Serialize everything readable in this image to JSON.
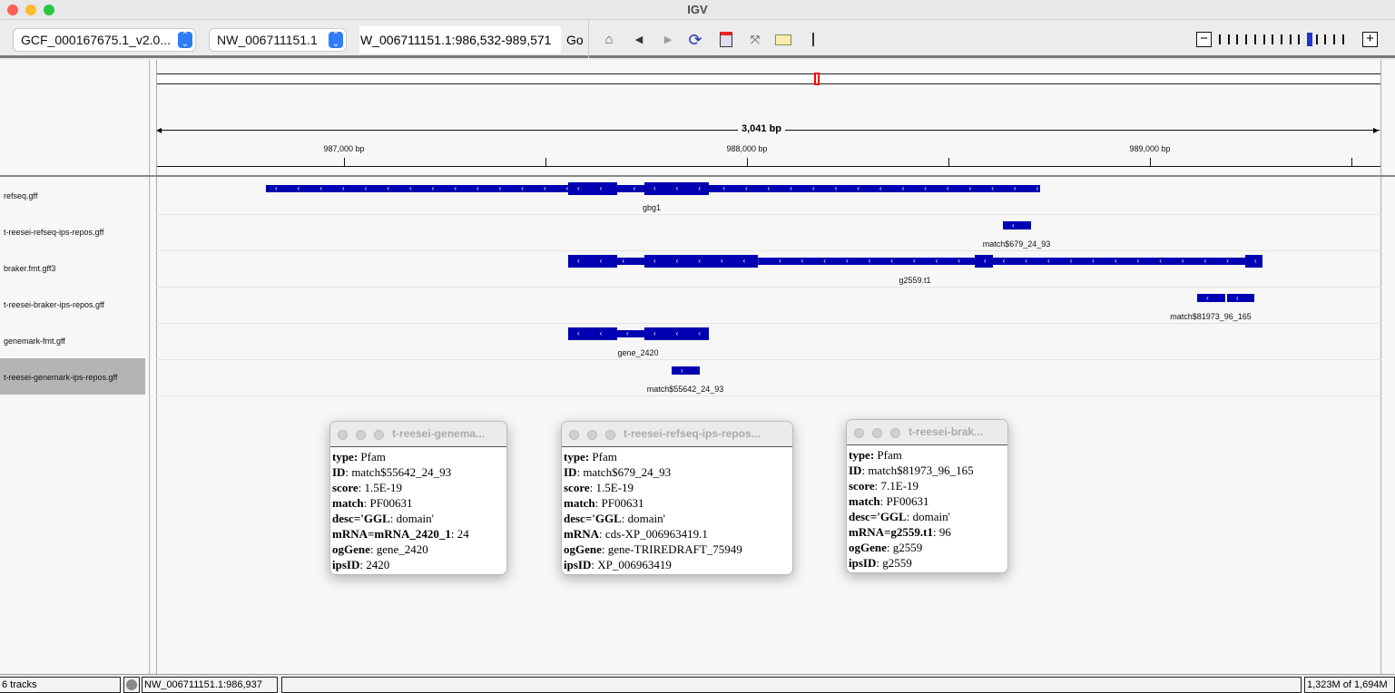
{
  "window": {
    "title": "IGV"
  },
  "toolbar": {
    "genome": "GCF_000167675.1_v2.0...",
    "chromosome": "NW_006711151.1",
    "locus": "W_006711151.1:986,532-989,571",
    "go_label": "Go",
    "icons": [
      "home-icon",
      "back-icon",
      "forward-icon",
      "refresh-icon",
      "roi-icon",
      "fit-icon",
      "popup-info-icon"
    ],
    "zoom_level_fraction": 0.73,
    "zoom_ticks": 15
  },
  "ruler": {
    "span": "3,041 bp",
    "ticks": [
      "987,000 bp",
      "988,000 bp",
      "989,000 bp"
    ]
  },
  "tracks": [
    {
      "name": "refseq.gff",
      "feature": "gbg1"
    },
    {
      "name": "t-reesei-refseq-ips-repos.gff",
      "feature": "match$679_24_93"
    },
    {
      "name": "braker.fmt.gff3",
      "feature": "g2559.t1"
    },
    {
      "name": "t-reesei-braker-ips-repos.gff",
      "feature": "match$81973_96_165"
    },
    {
      "name": "genemark-fmt.gff",
      "feature": "gene_2420"
    },
    {
      "name": "t-reesei-genemark-ips-repos.gff",
      "feature": "match$55642_24_93",
      "selected": true
    }
  ],
  "popups": [
    {
      "title": "t-reesei-genema...",
      "rows": [
        {
          "k": "type:",
          "v": " Pfam"
        },
        {
          "k": "ID",
          "v": ": match$55642_24_93"
        },
        {
          "k": "score",
          "v": ": 1.5E-19"
        },
        {
          "k": "match",
          "v": ": PF00631"
        },
        {
          "k": "desc='GGL",
          "v": ": domain'"
        },
        {
          "k": "mRNA=mRNA_2420_1",
          "v": ": 24"
        },
        {
          "k": "ogGene",
          "v": ": gene_2420"
        },
        {
          "k": "ipsID",
          "v": ": 2420"
        }
      ]
    },
    {
      "title": "t-reesei-refseq-ips-repos...",
      "rows": [
        {
          "k": "type:",
          "v": " Pfam"
        },
        {
          "k": "ID",
          "v": ": match$679_24_93"
        },
        {
          "k": "score",
          "v": ": 1.5E-19"
        },
        {
          "k": "match",
          "v": ": PF00631"
        },
        {
          "k": "desc='GGL",
          "v": ": domain'"
        },
        {
          "k": "mRNA",
          "v": ": cds-XP_006963419.1"
        },
        {
          "k": "ogGene",
          "v": ": gene-TRIREDRAFT_75949"
        },
        {
          "k": "ipsID",
          "v": ": XP_006963419"
        }
      ]
    },
    {
      "title": "t-reesei-brak...",
      "rows": [
        {
          "k": "type:",
          "v": " Pfam"
        },
        {
          "k": "ID",
          "v": ": match$81973_96_165"
        },
        {
          "k": "score",
          "v": ": 7.1E-19"
        },
        {
          "k": "match",
          "v": ": PF00631"
        },
        {
          "k": "desc='GGL",
          "v": ": domain'"
        },
        {
          "k": "mRNA=g2559.t1",
          "v": ": 96"
        },
        {
          "k": "ogGene",
          "v": ": g2559"
        },
        {
          "k": "ipsID",
          "v": ": g2559"
        }
      ]
    }
  ],
  "status": {
    "tracks": "6 tracks",
    "position": "NW_006711151.1:986,937",
    "memory": "1,323M of 1,694M"
  },
  "colors": {
    "feature": "#0000b2",
    "roi_marker": "#ff0000",
    "zoom_thumb": "#2233cc"
  }
}
